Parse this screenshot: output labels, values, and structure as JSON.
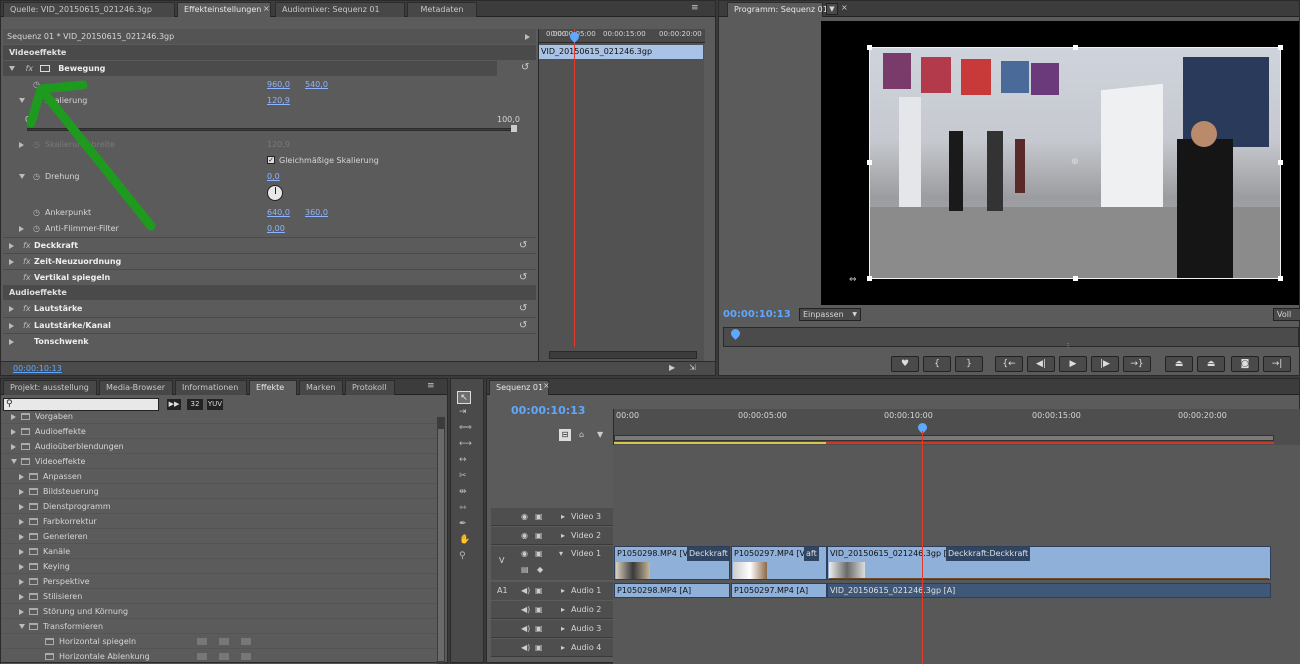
{
  "colors": {
    "accent_blue": "#5ea8ff",
    "playhead": "#e23a2a",
    "clip_blue": "#8fb0d8",
    "clip_dark": "#3f5878",
    "green_annotation": "#1e9a1e"
  },
  "effect_controls": {
    "tabs": [
      "Quelle: VID_20150615_021246.3gp",
      "Effekteinstellungen",
      "Audiomixer: Sequenz 01",
      "Metadaten"
    ],
    "breadcrumb": "Sequenz 01 * VID_20150615_021246.3gp",
    "ruler": [
      "00:00",
      "00:00:05:00",
      "00:00:15:00",
      "00:00:20:00"
    ],
    "clip_label": "VID_20150615_021246.3gp",
    "video_effects": "Videoeffekte",
    "motion": "Bewegung",
    "position": {
      "x": "960,0",
      "y": "540,0"
    },
    "scale": {
      "label": "Skalierung",
      "value": "120,9",
      "min": "0",
      "max": "100,0"
    },
    "scale_width": {
      "label": "Skalierungsbreite",
      "value": "120,9"
    },
    "uniform": "Gleichmäßige Skalierung",
    "rotation": {
      "label": "Drehung",
      "value": "0,0"
    },
    "anchor": {
      "label": "Ankerpunkt",
      "x": "640,0",
      "y": "360,0"
    },
    "antiflicker": {
      "label": "Anti-Flimmer-Filter",
      "value": "0,00"
    },
    "opacity": "Deckkraft",
    "time_remap": "Zeit-Neuzuordnung",
    "flip": "Vertikal spiegeln",
    "audio_effects": "Audioeffekte",
    "volume": "Lautstärke",
    "channel_volume": "Lautstärke/Kanal",
    "panner": "Tonschwenk",
    "timecode": "00:00:10:13"
  },
  "program": {
    "tab": "Programm: Sequenz 01",
    "timecode": "00:00:10:13",
    "fit": "Einpassen",
    "quality": "Voll"
  },
  "project": {
    "tabs": [
      "Projekt: ausstellung",
      "Media-Browser",
      "Informationen",
      "Effekte",
      "Marken",
      "Protokoll"
    ],
    "badges": [
      "32",
      "YUV"
    ],
    "tree": [
      {
        "label": "Vorgaben",
        "indent": 0,
        "state": "closed"
      },
      {
        "label": "Audioeffekte",
        "indent": 0,
        "state": "closed"
      },
      {
        "label": "Audioüberblendungen",
        "indent": 0,
        "state": "closed"
      },
      {
        "label": "Videoeffekte",
        "indent": 0,
        "state": "open"
      },
      {
        "label": "Anpassen",
        "indent": 1,
        "state": "closed"
      },
      {
        "label": "Bildsteuerung",
        "indent": 1,
        "state": "closed"
      },
      {
        "label": "Dienstprogramm",
        "indent": 1,
        "state": "closed"
      },
      {
        "label": "Farbkorrektur",
        "indent": 1,
        "state": "closed"
      },
      {
        "label": "Generieren",
        "indent": 1,
        "state": "closed"
      },
      {
        "label": "Kanäle",
        "indent": 1,
        "state": "closed"
      },
      {
        "label": "Keying",
        "indent": 1,
        "state": "closed"
      },
      {
        "label": "Perspektive",
        "indent": 1,
        "state": "closed"
      },
      {
        "label": "Stilisieren",
        "indent": 1,
        "state": "closed"
      },
      {
        "label": "Störung und Körnung",
        "indent": 1,
        "state": "closed"
      },
      {
        "label": "Transformieren",
        "indent": 1,
        "state": "open"
      },
      {
        "label": "Horizontal spiegeln",
        "indent": 2,
        "state": "item"
      },
      {
        "label": "Horizontale Ablenkung",
        "indent": 2,
        "state": "item"
      }
    ]
  },
  "timeline": {
    "tab": "Sequenz 01",
    "timecode": "00:00:10:13",
    "ruler": [
      "00:00",
      "00:00:05:00",
      "00:00:10:00",
      "00:00:15:00",
      "00:00:20:00"
    ],
    "tracks": {
      "v3": "Video 3",
      "v2": "Video 2",
      "v1": "Video 1",
      "a1": "Audio 1",
      "a2": "Audio 2",
      "a3": "Audio 3",
      "a4": "Audio 4",
      "v_src": "V",
      "a_src": "A1"
    },
    "clips": {
      "c1": "P1050298.MP4 [V]",
      "c1fx": "Deckkraft",
      "c2": "P1050297.MP4 [V]",
      "c2fx": "aft",
      "c3": "VID_20150615_021246.3gp [V]",
      "c3fx": "Deckkraft:Deckkraft",
      "a1": "P1050298.MP4 [A]",
      "a2": "P1050297.MP4 [A]",
      "a3": "VID_20150615_021246.3gp [A]"
    }
  }
}
